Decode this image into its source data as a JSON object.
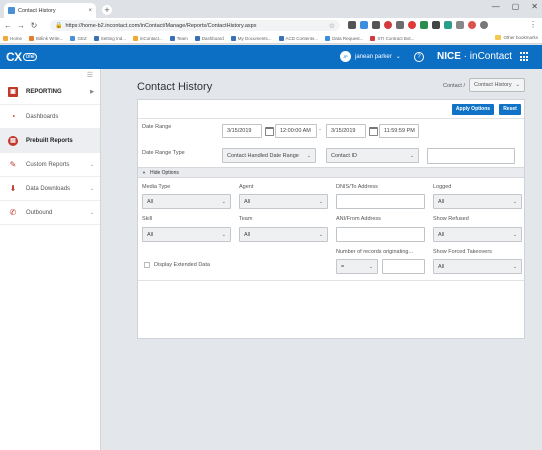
{
  "browser": {
    "tab_title": "Contact History",
    "tab_close": "×",
    "new_tab": "+",
    "url": "https://home-b2.incontact.com/inContact/Manage/Reports/ContactHistory.aspx",
    "window_controls": [
      "—",
      "▢",
      "✕"
    ],
    "bookmarks": [
      "Home",
      "Bitlink Write...",
      "GEZ",
      "Setting Ind...",
      "inContact...",
      "Team",
      "Dashboard",
      "My Documents...",
      "ACD Contents...",
      "Data Request...",
      "STI Contract Bot..."
    ],
    "other_bookmarks": "Other bookmarks"
  },
  "header": {
    "logo_main": "CX",
    "logo_sub": "one",
    "user_initials": "JP",
    "user_name": "janean parker",
    "help": "?",
    "brand_bold": "NICE",
    "brand_sep": " · ",
    "brand_light": "inContact"
  },
  "sidebar": {
    "items": [
      {
        "label": "REPORTING"
      },
      {
        "label": "Dashboards"
      },
      {
        "label": "Prebuilt Reports"
      },
      {
        "label": "Custom Reports"
      },
      {
        "label": "Data Downloads"
      },
      {
        "label": "Outbound"
      }
    ]
  },
  "page": {
    "title": "Contact History",
    "breadcrumb": "Contact /",
    "breadcrumb_select": "Contact History"
  },
  "toolbar": {
    "apply_label": "Apply Options",
    "reset_label": "Reset"
  },
  "form": {
    "date_range_label": "Date Range",
    "start_date": "3/15/2019",
    "start_time": "12:00:00 AM",
    "range_sep": "-",
    "end_date": "3/15/2019",
    "end_time": "11:59:59 PM",
    "date_range_type_label": "Date Range Type",
    "date_range_type_value": "Contact Handled Date Range",
    "id_type_value": "Contact ID",
    "id_value": "",
    "hide_options_label": "Hide Options",
    "media_type_label": "Media Type",
    "media_type_value": "All",
    "agent_label": "Agent",
    "agent_value": "All",
    "dnis_label": "DNIS/To Address",
    "dnis_value": "",
    "logged_label": "Logged",
    "logged_value": "All",
    "skill_label": "Skill",
    "skill_value": "All",
    "team_label": "Team",
    "team_value": "All",
    "ani_label": "ANI/From Address",
    "ani_value": "",
    "show_refused_label": "Show Refused",
    "show_refused_value": "All",
    "display_extended_label": "Display Extended Data",
    "num_records_label": "Number of records originating...",
    "num_records_op": "=",
    "num_records_value": "",
    "show_forced_label": "Show Forced Takeovers",
    "show_forced_value": "All"
  }
}
